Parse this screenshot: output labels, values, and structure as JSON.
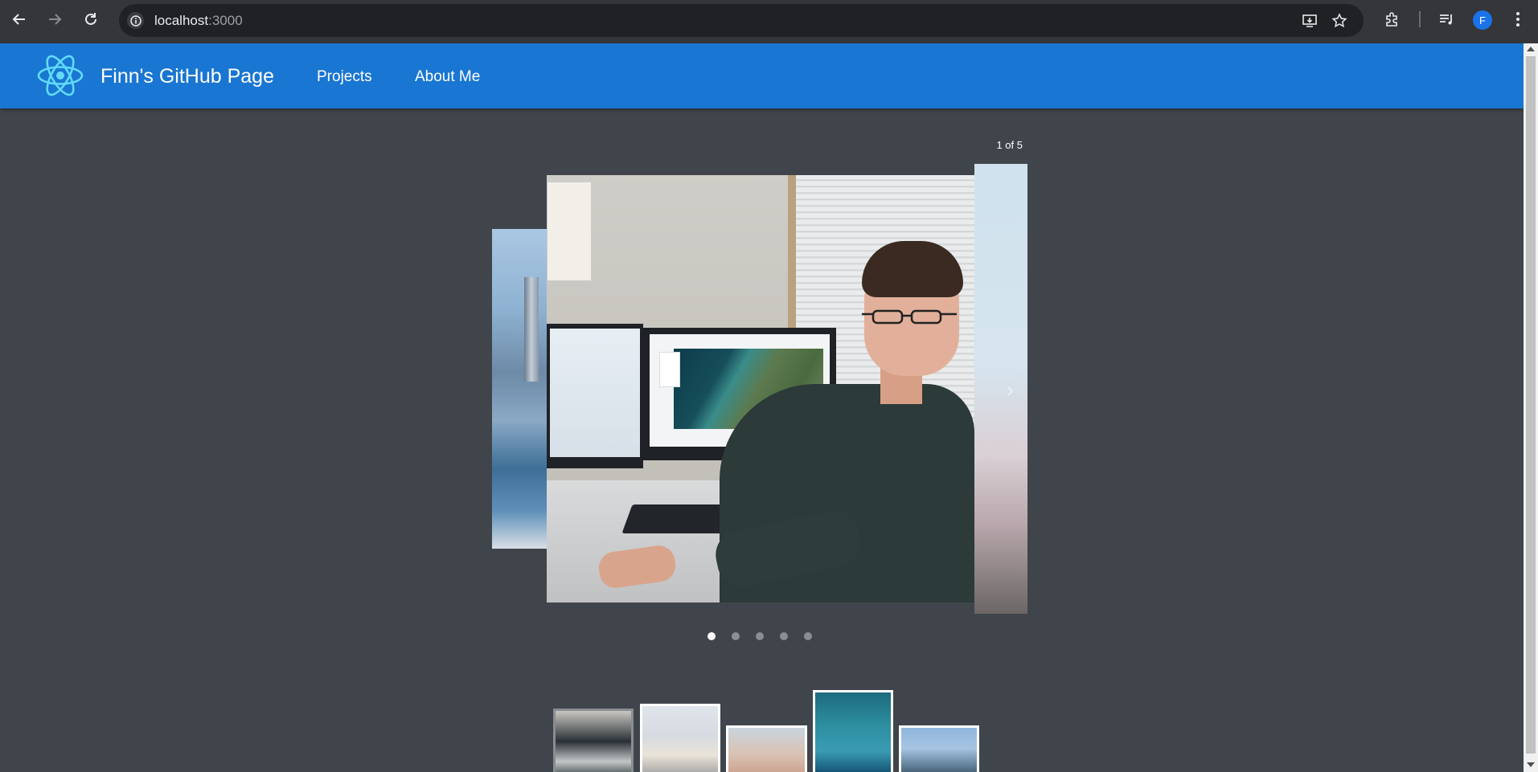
{
  "browser": {
    "url_host": "localhost",
    "url_port": ":3000",
    "profile_initial": "F",
    "icons": [
      "back-arrow-icon",
      "forward-arrow-icon",
      "reload-icon",
      "site-info-icon",
      "install-app-icon",
      "bookmark-star-icon",
      "extensions-icon",
      "media-controls-icon",
      "more-menu-icon"
    ]
  },
  "header": {
    "title": "Finn's GitHub Page",
    "nav": [
      {
        "label": "Projects"
      },
      {
        "label": "About Me"
      }
    ],
    "accent_color": "#1976d2"
  },
  "carousel": {
    "counter": "1 of 5",
    "current_index": 1,
    "total": 5,
    "dots": [
      true,
      false,
      false,
      false,
      false
    ]
  },
  "thumbnails": {
    "count": 5,
    "active": 1
  },
  "colors": {
    "page_background": "#40454b",
    "appbar": "#1976d2"
  }
}
